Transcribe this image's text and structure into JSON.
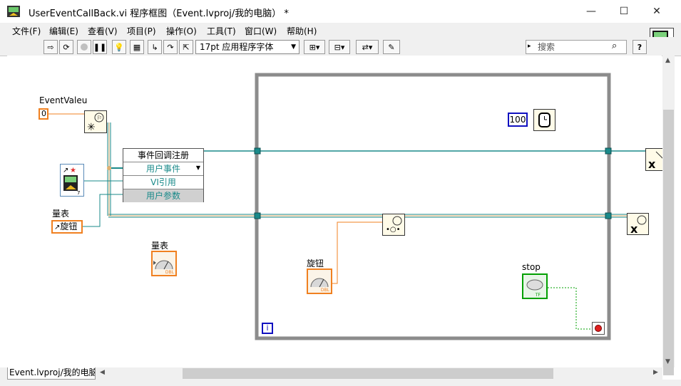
{
  "window": {
    "title": "UserEventCallBack.vi 程序框图（Event.lvproj/我的电脑） *",
    "minimize_glyph": "—",
    "maximize_glyph": "☐",
    "close_glyph": "✕"
  },
  "menu": [
    "文件(F)",
    "编辑(E)",
    "查看(V)",
    "项目(P)",
    "操作(O)",
    "工具(T)",
    "窗口(W)",
    "帮助(H)"
  ],
  "toolbar": {
    "font_selector": "17pt 应用程序字体",
    "search_placeholder": "搜索",
    "help_glyph": "?"
  },
  "diagram": {
    "event_value_label": "EventValeu",
    "event_value_const": "0",
    "gauge_ref_label": "量表",
    "knob_ref_value": "旋钮",
    "register_node": {
      "title": "事件回调注册",
      "rows": [
        "用户事件",
        "VI引用",
        "用户参数"
      ]
    },
    "gauge_terminal_label": "量表",
    "knob_terminal_label": "旋钮",
    "numeric_type": "DBL",
    "wait_const": "100",
    "stop_label": "stop",
    "bool_type": "TF",
    "loop_iteration": "i"
  },
  "tabs": {
    "active": "Event.lvproj/我的电脑"
  },
  "colors": {
    "wire_teal": "#1a8a8a",
    "int_orange": "#f08020",
    "bool_green": "#00a000",
    "loop_gray": "#8c8c8c",
    "const_blue": "#1010c0"
  }
}
